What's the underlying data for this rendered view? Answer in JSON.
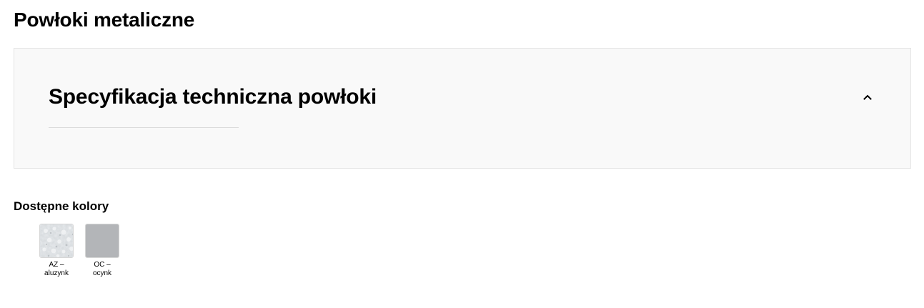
{
  "page_title": "Powłoki metaliczne",
  "accordion": {
    "title": "Specyfikacja techniczna powłoki",
    "expanded": true,
    "toggle_icon": "chevron-up-icon",
    "background": "#f9f9f9"
  },
  "colors": {
    "label": "Dostępne kolory",
    "items": [
      {
        "name": "AZ –\naluzynk",
        "swatch": "aluzynk-texture",
        "color": "#d9dde0"
      },
      {
        "name": "OC –\nocynk",
        "swatch": "ocynk-solid",
        "color": "#b3b5b8"
      }
    ]
  }
}
